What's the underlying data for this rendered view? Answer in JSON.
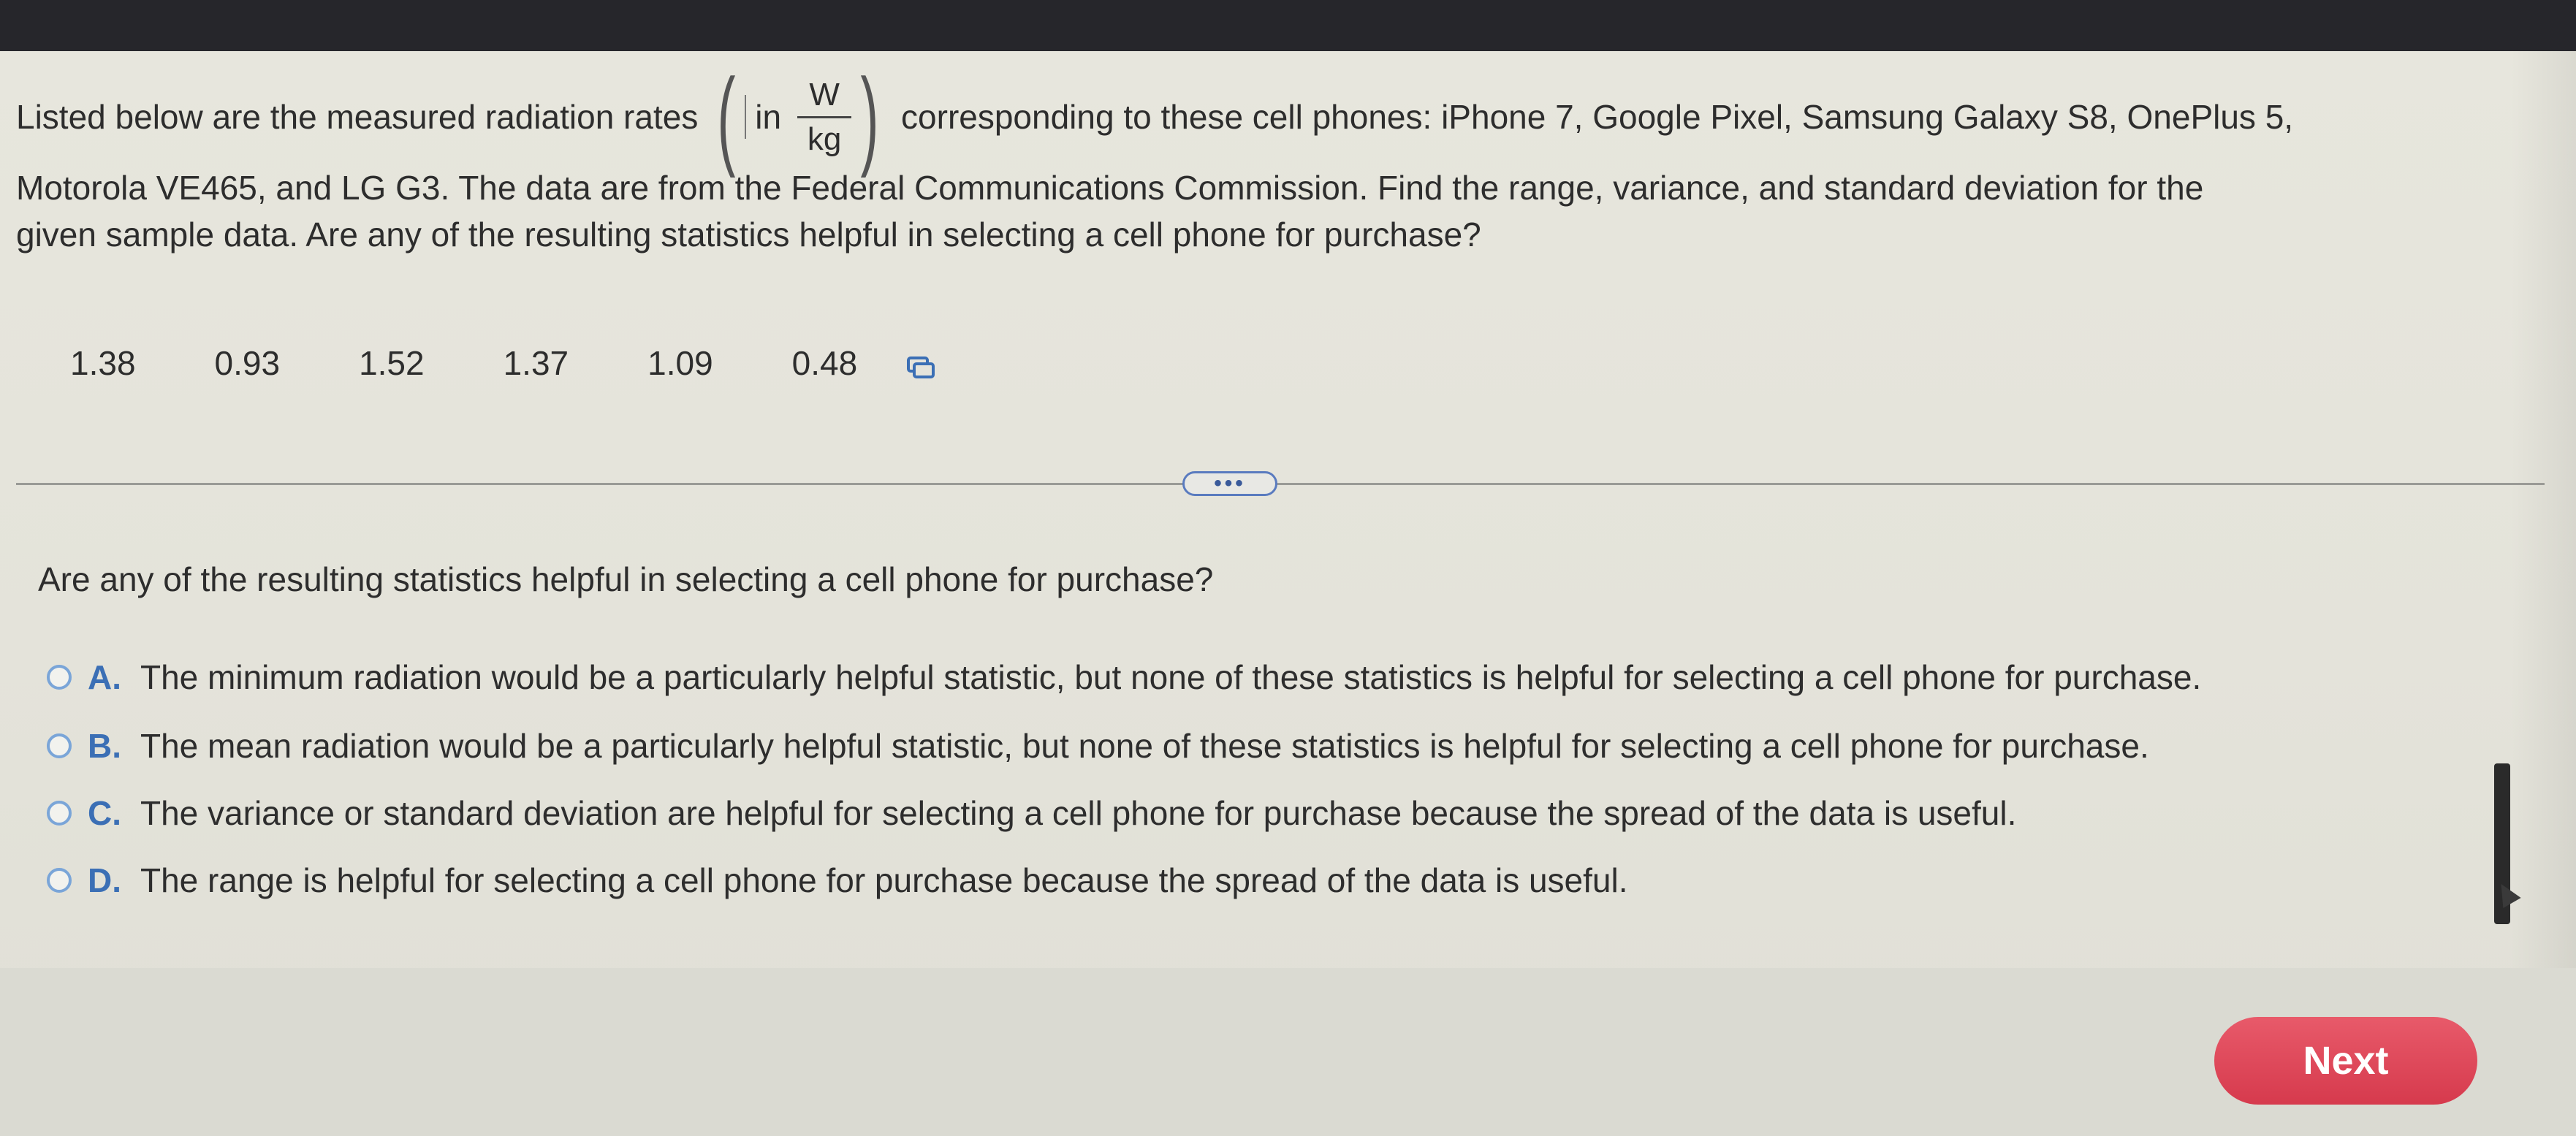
{
  "question": {
    "line1_before": "Listed below are the measured radiation rates",
    "unit_in": "in",
    "unit_numerator": "W",
    "unit_denominator": "kg",
    "line1_after": "corresponding to these cell phones: iPhone 7, Google Pixel, Samsung Galaxy S8, OnePlus 5,",
    "line2": "Motorola VE465, and LG G3. The data are from the Federal Communications Commission. Find the range, variance, and standard deviation for the",
    "line3": "given sample data. Are any of the resulting statistics helpful in selecting a cell phone for purchase?"
  },
  "data_values": [
    "1.38",
    "0.93",
    "1.52",
    "1.37",
    "1.09",
    "0.48"
  ],
  "icons": {
    "copy": "copy-icon",
    "expand": "more-dots-icon",
    "radio": "radio-unselected-icon"
  },
  "divider_handle": "•••",
  "prompt": "Are any of the resulting statistics helpful in selecting a cell phone for purchase?",
  "options": [
    {
      "letter": "A.",
      "text": "The minimum radiation would be a particularly helpful statistic, but none of these statistics is helpful for selecting a cell phone for purchase."
    },
    {
      "letter": "B.",
      "text": "The mean radiation would be a particularly helpful statistic, but none of these statistics is helpful for selecting a cell phone for purchase."
    },
    {
      "letter": "C.",
      "text": "The variance or standard deviation are helpful for selecting a cell phone for purchase because the spread of the data is useful."
    },
    {
      "letter": "D.",
      "text": "The range is helpful for selecting a cell phone for purchase because the spread of the data is useful."
    }
  ],
  "next_label": "Next",
  "colors": {
    "accent_blue": "#3b6fb5",
    "next_red": "#d63a4d",
    "background": "#e5e4db"
  }
}
